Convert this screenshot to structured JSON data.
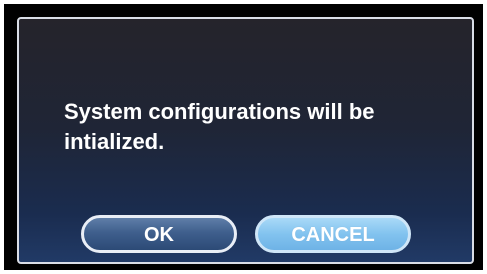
{
  "dialog": {
    "message": "System configurations will be intialized.",
    "ok_label": "OK",
    "cancel_label": "CANCEL"
  }
}
